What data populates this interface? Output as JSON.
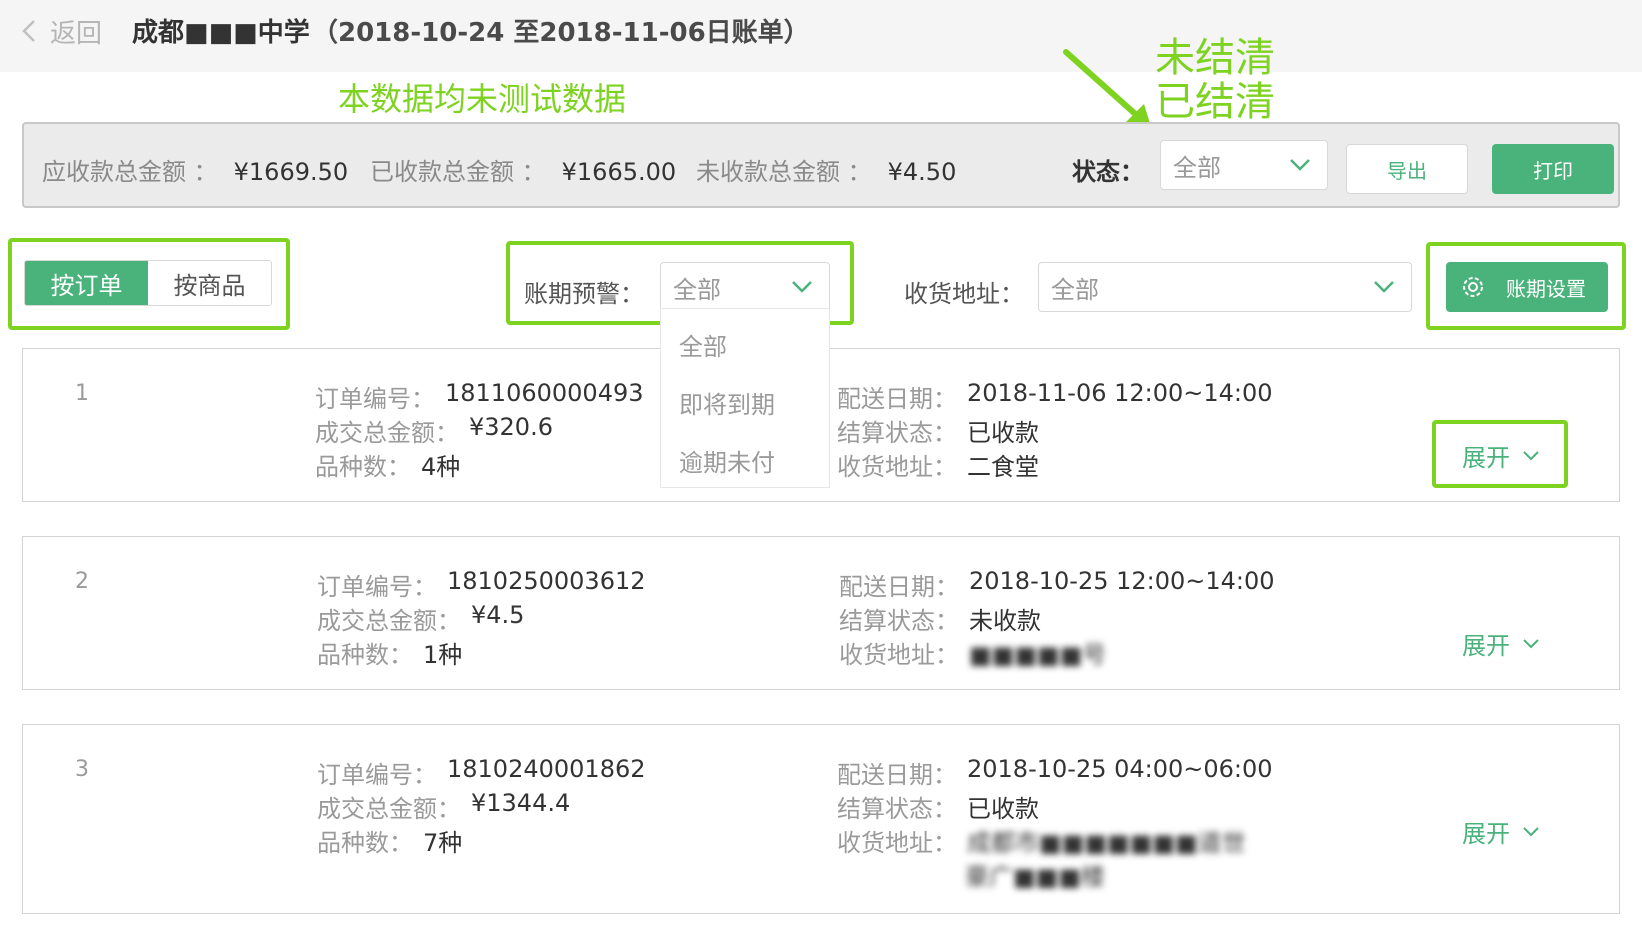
{
  "header": {
    "back_label": "返回",
    "title": "成都■■■中学",
    "subtitle": "（2018-10-24 至2018-11-06日账单）"
  },
  "annotations": {
    "note": "本数据均未测试数据",
    "status_option_1": "未结清",
    "status_option_2": "已结清"
  },
  "summary": {
    "receivable_label": "应收款总金额 ：",
    "receivable_value": "¥1669.50",
    "received_label": "已收款总金额 ：",
    "received_value": "¥1665.00",
    "unreceived_label": "未收款总金额 ：",
    "unreceived_value": "¥4.50",
    "status_label": "状态：",
    "status_value": "全部",
    "export_label": "导出",
    "print_label": "打印"
  },
  "filters": {
    "by_order": "按订单",
    "by_product": "按商品",
    "period_warning_label": "账期预警：",
    "period_warning_value": "全部",
    "period_warning_options": [
      "全部",
      "即将到期",
      "逾期未付"
    ],
    "address_label": "收货地址：",
    "address_value": "全部",
    "settings_label": "账期设置"
  },
  "orders": [
    {
      "index": "1",
      "order_no_label": "订单编号：",
      "order_no": "1811060000493",
      "amount_label": "成交总金额：",
      "amount": "¥320.6",
      "kinds_label": "品种数：",
      "kinds": "4种",
      "delivery_label": "配送日期：",
      "delivery": "2018-11-06 12:00~14:00",
      "settle_label": "结算状态：",
      "settle": "已收款",
      "address_label": "收货地址：",
      "address": "二食堂",
      "expand_label": "展开"
    },
    {
      "index": "2",
      "order_no_label": "订单编号：",
      "order_no": "1810250003612",
      "amount_label": "成交总金额：",
      "amount": "¥4.5",
      "kinds_label": "品种数：",
      "kinds": "1种",
      "delivery_label": "配送日期：",
      "delivery": "2018-10-25 12:00~14:00",
      "settle_label": "结算状态：",
      "settle": "未收款",
      "address_label": "收货地址：",
      "address": "■■■■■号",
      "expand_label": "展开"
    },
    {
      "index": "3",
      "order_no_label": "订单编号：",
      "order_no": "1810240001862",
      "amount_label": "成交总金额：",
      "amount": "¥1344.4",
      "kinds_label": "品种数：",
      "kinds": "7种",
      "delivery_label": "配送日期：",
      "delivery": "2018-10-25 04:00~06:00",
      "settle_label": "结算状态：",
      "settle": "已收款",
      "address_label": "收货地址：",
      "address": "成都市■■■■■■■道世",
      "address_line2": "豪广■■■楼",
      "expand_label": "展开"
    }
  ],
  "colors": {
    "accent": "#4ab27b",
    "annotation": "#7ed321"
  }
}
